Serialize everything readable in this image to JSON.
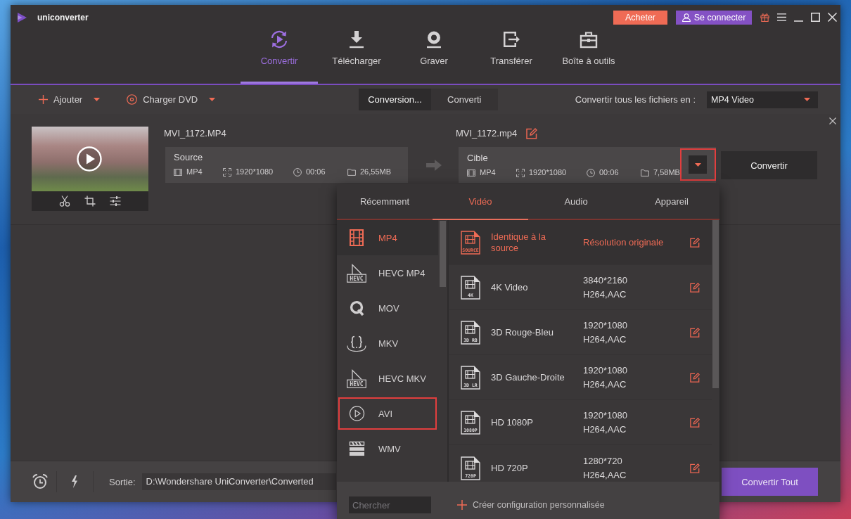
{
  "title_bar": {
    "app_name": "uniconverter",
    "buy_button": "Acheter",
    "login_button": "Se connecter"
  },
  "nav_tabs": [
    {
      "kind": "convert",
      "label": "Convertir",
      "selected": true
    },
    {
      "kind": "download",
      "label": "Télécharger",
      "selected": false
    },
    {
      "kind": "burn",
      "label": "Graver",
      "selected": false
    },
    {
      "kind": "transfer",
      "label": "Transférer",
      "selected": false
    },
    {
      "kind": "toolbox",
      "label": "Boîte à outils",
      "selected": false
    }
  ],
  "toolbar": {
    "add_button": "Ajouter",
    "dvd_button": "Charger DVD",
    "view_tabs": [
      {
        "label": "Conversion...",
        "selected": true
      },
      {
        "label": "Converti",
        "selected": false
      }
    ],
    "output_format_label": "Convertir tous les fichiers en :",
    "output_format": "MP4 Video"
  },
  "file": {
    "source_name": "MVI_1172.MP4",
    "source": {
      "label": "Source",
      "format": "MP4",
      "resolution": "1920*1080",
      "duration": "00:06",
      "size": "26,55MB"
    },
    "target_name": "MVI_1172.mp4",
    "target": {
      "label": "Cible",
      "format": "MP4",
      "resolution": "1920*1080",
      "duration": "00:06",
      "size": "7,58MB"
    },
    "format_menu_highlighted": true,
    "convert_button": "Convertir"
  },
  "format_menu": {
    "tabs": [
      {
        "label": "Récemment",
        "selected": false
      },
      {
        "label": "Vidéo",
        "selected": true
      },
      {
        "label": "Audio",
        "selected": false
      },
      {
        "label": "Appareil",
        "selected": false
      }
    ],
    "formats": [
      {
        "kind": "film",
        "label": "MP4",
        "selected": true,
        "highlighted": false
      },
      {
        "kind": "hevc",
        "badge": "HEVC",
        "label": "HEVC MP4",
        "selected": false,
        "highlighted": false
      },
      {
        "kind": "mov",
        "label": "MOV",
        "selected": false,
        "highlighted": false
      },
      {
        "kind": "mkv",
        "label": "MKV",
        "selected": false,
        "highlighted": false
      },
      {
        "kind": "hevc",
        "badge": "HEVC",
        "label": "HEVC MKV",
        "selected": false,
        "highlighted": false
      },
      {
        "kind": "avi",
        "label": "AVI",
        "selected": false,
        "highlighted": true
      },
      {
        "kind": "wmv",
        "label": "WMV",
        "selected": false,
        "highlighted": false
      }
    ],
    "presets": [
      {
        "badge": "SOURCE",
        "name": "Identique à la source",
        "specs": [
          "Résolution originale"
        ],
        "selected": true
      },
      {
        "badge": "4K",
        "name": "4K Video",
        "specs": [
          "3840*2160",
          "H264,AAC"
        ],
        "selected": false
      },
      {
        "badge": "3D RB",
        "name": "3D Rouge-Bleu",
        "specs": [
          "1920*1080",
          "H264,AAC"
        ],
        "selected": false
      },
      {
        "badge": "3D LR",
        "name": "3D Gauche-Droite",
        "specs": [
          "1920*1080",
          "H264,AAC"
        ],
        "selected": false
      },
      {
        "badge": "1080P",
        "name": "HD 1080P",
        "specs": [
          "1920*1080",
          "H264,AAC"
        ],
        "selected": false
      },
      {
        "badge": "720P",
        "name": "HD 720P",
        "specs": [
          "1280*720",
          "H264,AAC"
        ],
        "selected": false
      }
    ],
    "search": {
      "placeholder": "Chercher"
    },
    "create_button": "Créer configuration personnalisée"
  },
  "bottom_bar": {
    "output_label": "Sortie:",
    "output_path": "D:\\Wondershare UniConverter\\Converted",
    "convert_all_button": "Convertir Tout"
  }
}
